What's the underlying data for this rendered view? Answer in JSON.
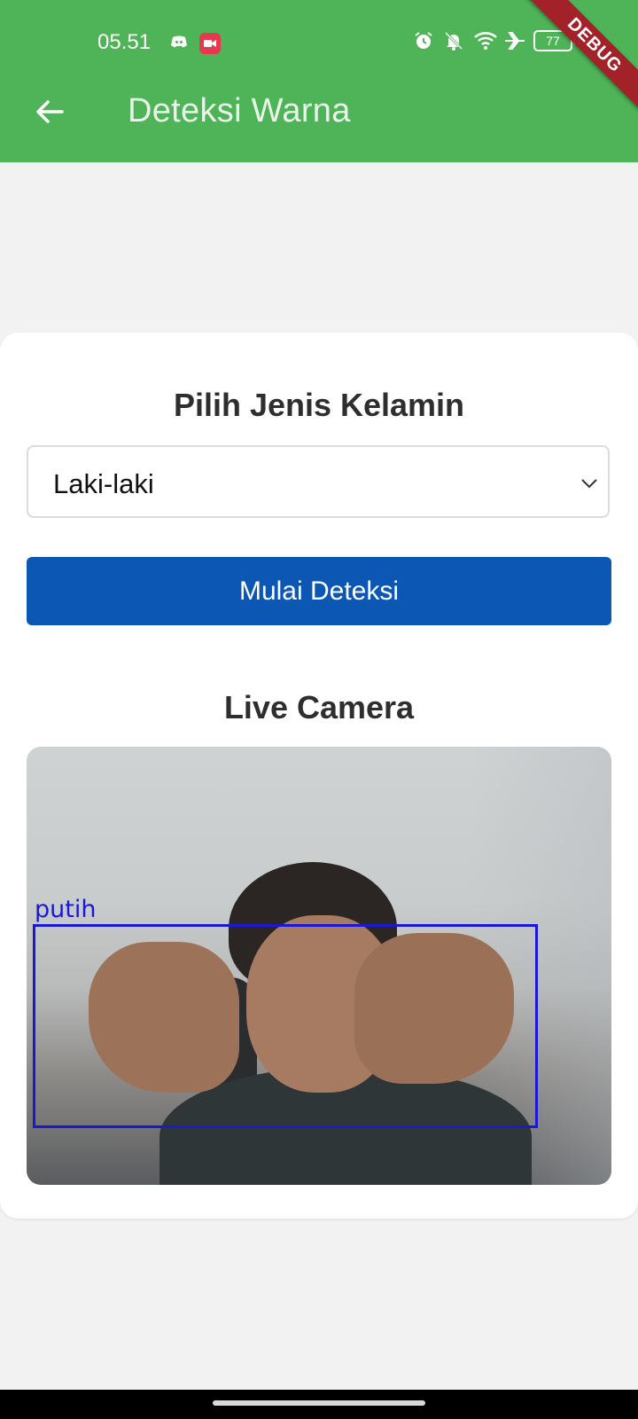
{
  "status_bar": {
    "time": "05.51",
    "battery_level": "77",
    "left_icons": [
      "discord-icon",
      "screen-record-icon"
    ],
    "right_icons": [
      "alarm-icon",
      "mute-icon",
      "wifi-icon",
      "airplane-icon",
      "battery-icon"
    ]
  },
  "debug_banner": "DEBUG",
  "appbar": {
    "title": "Deteksi Warna",
    "back_icon": "back-arrow-icon",
    "color": "#4fb458"
  },
  "form": {
    "gender_title": "Pilih Jenis Kelamin",
    "gender_selected": "Laki-laki",
    "start_button_label": "Mulai Deteksi",
    "button_color": "#0c57b3"
  },
  "camera": {
    "title": "Live Camera",
    "detection_label": "putih",
    "box_color": "#1a18d6"
  }
}
